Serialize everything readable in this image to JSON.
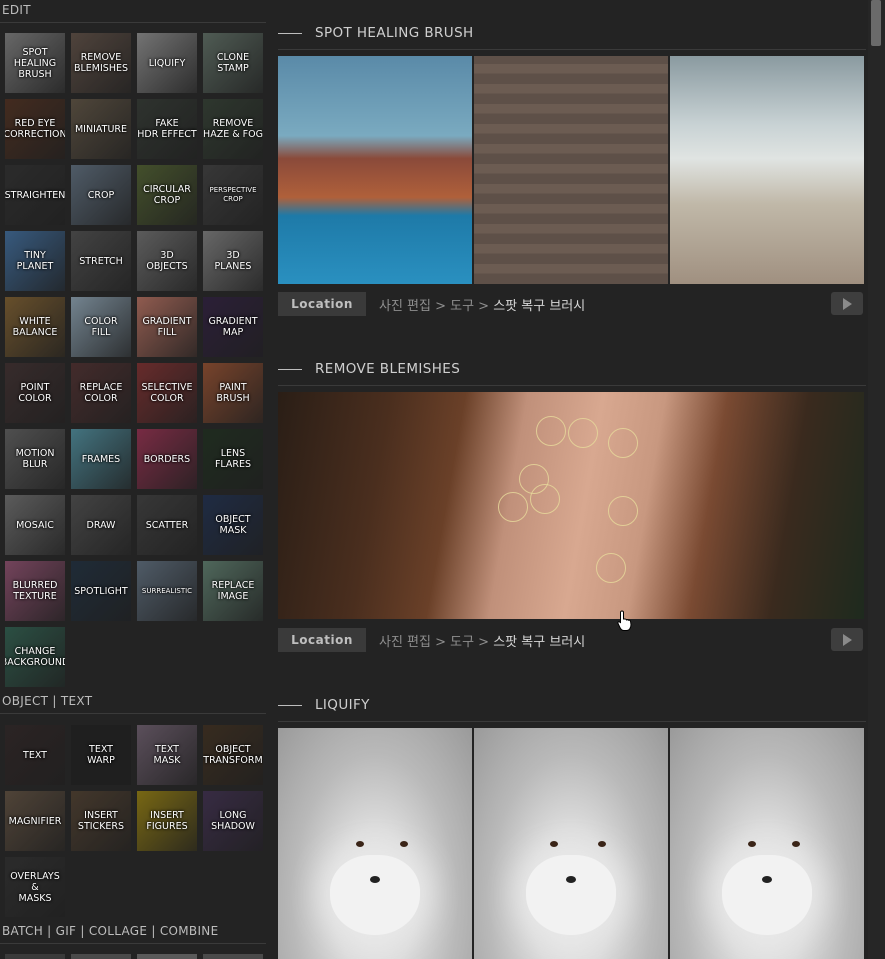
{
  "sidebar": {
    "edit_header": "EDIT",
    "object_header": "OBJECT  |  TEXT",
    "batch_header": "BATCH  |  GIF  |  COLLAGE  |  COMBINE",
    "edit_tools": [
      {
        "label": "SPOT\nHEALING\nBRUSH",
        "color": "#8a8a8a"
      },
      {
        "label": "REMOVE\nBLEMISHES",
        "color": "#6a5a50"
      },
      {
        "label": "LIQUIFY",
        "color": "#9a9a9a"
      },
      {
        "label": "CLONE\nSTAMP",
        "color": "#6a7a70"
      },
      {
        "label": "RED EYE\nCORRECTION",
        "color": "#5a3a2a"
      },
      {
        "label": "MINIATURE",
        "color": "#6a5e4e"
      },
      {
        "label": "FAKE\nHDR EFFECT",
        "color": "#3e443e"
      },
      {
        "label": "REMOVE\nHAZE & FOG",
        "color": "#3e4a3e"
      },
      {
        "label": "STRAIGHTEN",
        "color": "#3a3a3a"
      },
      {
        "label": "CROP",
        "color": "#6a7a8a"
      },
      {
        "label": "CIRCULAR\nCROP",
        "color": "#5a6a3a"
      },
      {
        "label": "PERSPECTIVE\nCROP",
        "color": "#4a4a4a"
      },
      {
        "label": "TINY\nPLANET",
        "color": "#4a78a8"
      },
      {
        "label": "STRETCH",
        "color": "#5a5a5a"
      },
      {
        "label": "3D\nOBJECTS",
        "color": "#7a7a7a"
      },
      {
        "label": "3D\nPLANES",
        "color": "#8a8a8a"
      },
      {
        "label": "WHITE\nBALANCE",
        "color": "#8a6a3a"
      },
      {
        "label": "COLOR\nFILL",
        "color": "#9ab0c0"
      },
      {
        "label": "GRADIENT\nFILL",
        "color": "#c07a6a"
      },
      {
        "label": "GRADIENT\nMAP",
        "color": "#3a2a4a"
      },
      {
        "label": "POINT\nCOLOR",
        "color": "#4a3a3a"
      },
      {
        "label": "REPLACE\nCOLOR",
        "color": "#5a3a3a"
      },
      {
        "label": "SELECTIVE\nCOLOR",
        "color": "#8a3a3a"
      },
      {
        "label": "PAINT\nBRUSH",
        "color": "#a05a3a"
      },
      {
        "label": "MOTION\nBLUR",
        "color": "#6a6a6a"
      },
      {
        "label": "FRAMES",
        "color": "#5a9aaa"
      },
      {
        "label": "BORDERS",
        "color": "#a03a5a"
      },
      {
        "label": "LENS\nFLARES",
        "color": "#2a3a2a"
      },
      {
        "label": "MOSAIC",
        "color": "#7a7a7a"
      },
      {
        "label": "DRAW",
        "color": "#5a5a5a"
      },
      {
        "label": "SCATTER",
        "color": "#4a4a4a"
      },
      {
        "label": "OBJECT\nMASK",
        "color": "#2a3a5a"
      },
      {
        "label": "BLURRED\nTEXTURE",
        "color": "#9a5a7a"
      },
      {
        "label": "SPOTLIGHT",
        "color": "#2a3a4a"
      },
      {
        "label": "SURREALISTIC",
        "color": "#6a7a8a"
      },
      {
        "label": "REPLACE\nIMAGE",
        "color": "#6a8a7a"
      },
      {
        "label": "CHANGE\nBACKGROUND",
        "color": "#3a6a5a"
      }
    ],
    "object_tools": [
      {
        "label": "TEXT",
        "color": "#3a3030"
      },
      {
        "label": "TEXT\nWARP",
        "color": "#2a2a2a"
      },
      {
        "label": "TEXT\nMASK",
        "color": "#7a6a7a"
      },
      {
        "label": "OBJECT\nTRANSFORM",
        "color": "#4a3a2a"
      },
      {
        "label": "MAGNIFIER",
        "color": "#6a5a4a"
      },
      {
        "label": "INSERT\nSTICKERS",
        "color": "#5a4a3a"
      },
      {
        "label": "INSERT\nFIGURES",
        "color": "#a08a1a"
      },
      {
        "label": "LONG\nSHADOW",
        "color": "#4a3a5a"
      },
      {
        "label": "OVERLAYS\n&\nMASKS",
        "color": "#3a3a3a"
      }
    ]
  },
  "sections": [
    {
      "title": "SPOT HEALING BRUSH",
      "location_label": "Location",
      "path_prefix": "사진 편집  >  도구  >  ",
      "path_current": "스팟 복구 브러시"
    },
    {
      "title": "REMOVE BLEMISHES",
      "location_label": "Location",
      "path_prefix": "사진 편집  >  도구  >  ",
      "path_current": "스팟 복구 브러시"
    },
    {
      "title": "LIQUIFY"
    }
  ],
  "icons": {
    "play": "play-icon",
    "cursor": "hand-pointer-icon"
  }
}
